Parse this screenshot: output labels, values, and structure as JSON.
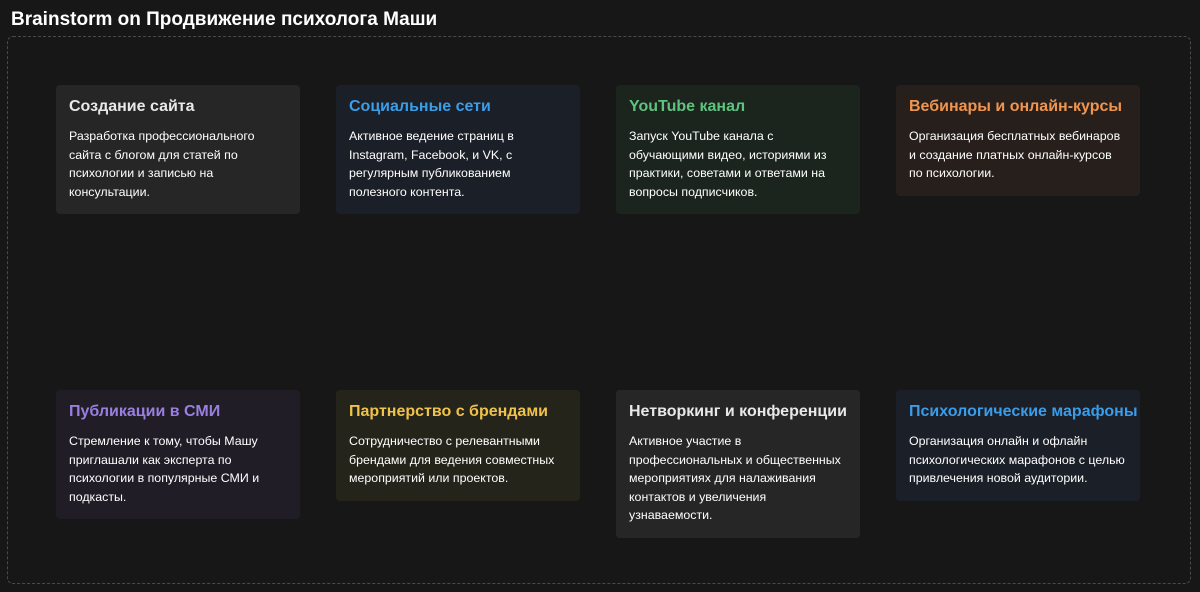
{
  "page": {
    "title": "Brainstorm on Продвижение психолога Маши"
  },
  "colors": {
    "background": "#171717",
    "title": "#ffffff",
    "body_text": "#ffffff"
  },
  "cards": [
    {
      "title": "Создание сайта",
      "body": "Разработка профессионального сайта с блогом для статей по психологии и записью на консультации.",
      "title_color": "#e8e8e8",
      "bg_color": "#262626"
    },
    {
      "title": "Социальные сети",
      "body": "Активное ведение страниц в Instagram, Facebook, и VK, с регулярным публикованием полезного контента.",
      "title_color": "#3b9ce8",
      "bg_color": "#1b1f27"
    },
    {
      "title": "YouTube канал",
      "body": "Запуск YouTube канала с обучающими видео, историями из практики, советами и ответами на вопросы подписчиков.",
      "title_color": "#5fc27e",
      "bg_color": "#1b251d"
    },
    {
      "title": "Вебинары и онлайн-курсы",
      "body": "Организация бесплатных вебинаров и создание платных онлайн-курсов по психологии.",
      "title_color": "#ef9550",
      "bg_color": "#271f1b"
    },
    {
      "title": "Публикации в СМИ",
      "body": "Стремление к тому, чтобы Машу приглашали как эксперта по психологии в популярные СМИ и подкасты.",
      "title_color": "#9a7fe0",
      "bg_color": "#211d27"
    },
    {
      "title": "Партнерство с брендами",
      "body": "Сотрудничество с релевантными брендами для ведения совместных мероприятий или проектов.",
      "title_color": "#f0c24a",
      "bg_color": "#25241b"
    },
    {
      "title": "Нетворкинг и конференции",
      "body": "Активное участие в профессиональных и общественных мероприятиях для налаживания контактов и увеличения узнаваемости.",
      "title_color": "#e8e8e8",
      "bg_color": "#262626"
    },
    {
      "title": "Психологические марафоны",
      "body": "Организация онлайн и офлайн психологических марафонов с целью привлечения новой аудитории.",
      "title_color": "#3b9ce8",
      "bg_color": "#1b1f27"
    }
  ]
}
